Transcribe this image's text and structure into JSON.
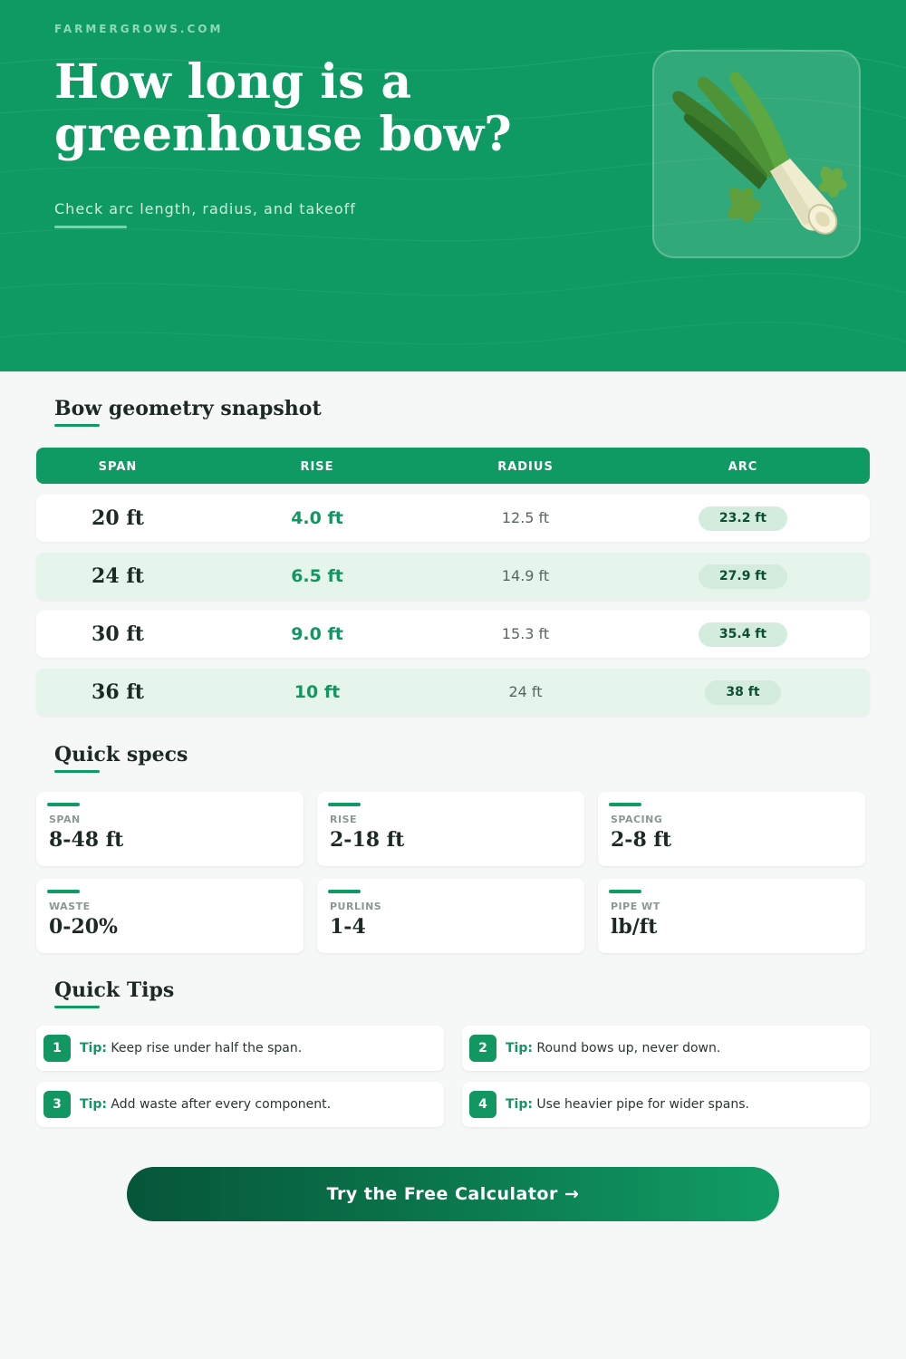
{
  "hero": {
    "brand": "FARMERGROWS.COM",
    "title": "How long is a greenhouse bow?",
    "subtitle": "Check arc length, radius, and takeoff",
    "image_icon": "leek-icon"
  },
  "geometry": {
    "title": "Bow geometry snapshot",
    "headers": [
      "SPAN",
      "RISE",
      "RADIUS",
      "ARC"
    ],
    "rows": [
      {
        "span": "20 ft",
        "rise": "4.0 ft",
        "radius": "12.5 ft",
        "arc": "23.2 ft"
      },
      {
        "span": "24 ft",
        "rise": "6.5 ft",
        "radius": "14.9 ft",
        "arc": "27.9 ft"
      },
      {
        "span": "30 ft",
        "rise": "9.0 ft",
        "radius": "15.3 ft",
        "arc": "35.4 ft"
      },
      {
        "span": "36 ft",
        "rise": "10 ft",
        "radius": "24 ft",
        "arc": "38 ft"
      }
    ]
  },
  "specs": {
    "title": "Quick specs",
    "items": [
      {
        "label": "SPAN",
        "value": "8-48 ft"
      },
      {
        "label": "RISE",
        "value": "2-18 ft"
      },
      {
        "label": "SPACING",
        "value": "2-8 ft"
      },
      {
        "label": "WASTE",
        "value": "0-20%"
      },
      {
        "label": "PURLINS",
        "value": "1-4"
      },
      {
        "label": "PIPE WT",
        "value": "lb/ft"
      }
    ]
  },
  "tips": {
    "title": "Quick Tips",
    "prefix": "Tip:",
    "items": [
      {
        "num": "1",
        "text": "Keep rise under half the span."
      },
      {
        "num": "2",
        "text": "Round bows up, never down."
      },
      {
        "num": "3",
        "text": "Add waste after every component."
      },
      {
        "num": "4",
        "text": "Use heavier pipe for wider spans."
      }
    ]
  },
  "cta": {
    "label": "Try the Free Calculator →"
  },
  "colors": {
    "brand_green": "#0f9a63",
    "dark_green": "#06563a",
    "pill_bg": "#d3ecde",
    "row_alt": "#e6f5ec"
  }
}
